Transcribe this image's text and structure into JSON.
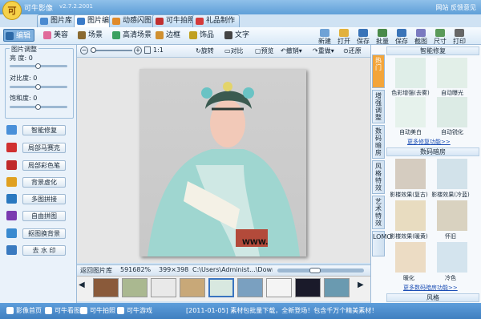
{
  "app": {
    "title": "可牛影像",
    "version": "v2.7.2.2001",
    "logo": "可"
  },
  "top_links": "网站  反馈意见",
  "main_tabs": [
    {
      "label": "图片库",
      "icon": "photo-library-icon",
      "color": "#4a8ad0"
    },
    {
      "label": "图片编辑",
      "icon": "image-edit-icon",
      "color": "#3a7bc8"
    },
    {
      "label": "动感闪图",
      "icon": "animation-icon",
      "color": "#e08a2a"
    },
    {
      "label": "可牛拍照",
      "icon": "camera-icon",
      "color": "#c03030"
    },
    {
      "label": "礼品制作",
      "icon": "gift-icon",
      "color": "#d43a3a"
    }
  ],
  "tools": [
    {
      "label": "编辑",
      "icon": "crop-icon",
      "color": "#2e6aa8"
    },
    {
      "label": "美容",
      "icon": "makeup-icon",
      "color": "#e06a9a"
    },
    {
      "label": "场景",
      "icon": "scene-icon",
      "color": "#8a6a30"
    },
    {
      "label": "高清场景",
      "icon": "hd-scene-icon",
      "color": "#3aa060"
    },
    {
      "label": "边框",
      "icon": "frame-icon",
      "color": "#d09030"
    },
    {
      "label": "饰品",
      "icon": "accessory-icon",
      "color": "#c0a020"
    },
    {
      "label": "文字",
      "icon": "text-icon",
      "color": "#444"
    }
  ],
  "right_tools": [
    {
      "label": "新建",
      "icon": "new-file-icon"
    },
    {
      "label": "打开",
      "icon": "open-folder-icon"
    },
    {
      "label": "保存",
      "icon": "save-icon"
    },
    {
      "label": "批量",
      "icon": "batch-icon"
    },
    {
      "label": "保存",
      "icon": "save-as-icon"
    },
    {
      "label": "截图",
      "icon": "screenshot-icon"
    },
    {
      "label": "尺寸",
      "icon": "resize-icon"
    },
    {
      "label": "打印",
      "icon": "print-icon"
    }
  ],
  "left_panel": {
    "adjust_title": "图片调整",
    "sliders": [
      {
        "label": "亮 度: 0",
        "value": 0.5
      },
      {
        "label": "对比度: 0",
        "value": 0.5
      },
      {
        "label": "饱和度: 0",
        "value": 0.5
      }
    ],
    "buttons": [
      {
        "label": "智能修复",
        "icon": "smart-fix-icon",
        "color": "#4a90d9"
      },
      {
        "label": "局部马赛克",
        "icon": "mosaic-icon",
        "color": "#d03030"
      },
      {
        "label": "局部彩色笔",
        "icon": "color-pen-icon",
        "color": "#c02a2a"
      },
      {
        "label": "背景虚化",
        "icon": "blur-bg-icon",
        "color": "#e0a020"
      },
      {
        "label": "多图拼接",
        "icon": "collage-icon",
        "color": "#2a78c0"
      },
      {
        "label": "自由拼图",
        "icon": "free-collage-icon",
        "color": "#7a3ab0"
      },
      {
        "label": "抠图换背景",
        "icon": "cutout-icon",
        "color": "#3a8ad0"
      },
      {
        "label": "去 水 印",
        "icon": "watermark-icon",
        "color": "#3a7ac0"
      }
    ]
  },
  "canvas_toolbar": {
    "zoom": "1:1",
    "items": [
      "旋转",
      "对比",
      "预览",
      "撤销",
      "重做",
      "还原"
    ]
  },
  "photo": {
    "watermark": "WWW."
  },
  "info_bar": {
    "library_label": "返回图片库",
    "zoom": "591682%",
    "size": "399×398",
    "path": "C:\\Users\\Administ...\\Downloads"
  },
  "right_panel": {
    "vtabs": [
      "热门",
      "增强调整",
      "数码暗房",
      "风格特效",
      "艺术特效",
      "LOMO"
    ],
    "section1_title": "智能修复",
    "section1_items": [
      "色彩增强(去雾)",
      "自动曝光",
      "自动美白",
      "自动锐化"
    ],
    "section1_link": "更多修复功能>>",
    "section2_title": "数码暗房",
    "section2_items": [
      "影楼效果(复古)",
      "影楼效果(冷蓝)",
      "影楼效果(暖黄)",
      "怀旧",
      "暖化",
      "冷色"
    ],
    "section2_link": "更多数码暗房功能>>",
    "section3_title": "风格"
  },
  "statusbar": {
    "items": [
      "影像首页",
      "可牛看图",
      "可牛拍照",
      "可牛游戏"
    ],
    "message": "[2011-01-05] 素材包批量下载，全新登场！包含千万个精美素材！"
  }
}
